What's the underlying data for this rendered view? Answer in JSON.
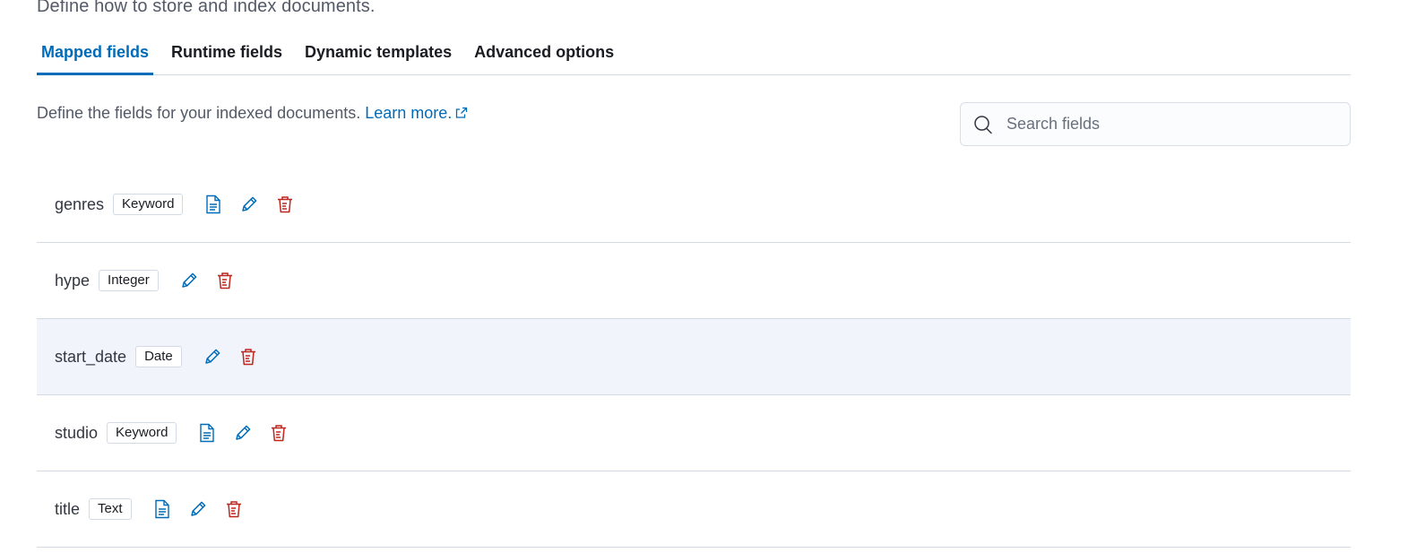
{
  "header": {
    "subtitle": "Define how to store and index documents."
  },
  "tabs": [
    {
      "label": "Mapped fields",
      "active": true
    },
    {
      "label": "Runtime fields",
      "active": false
    },
    {
      "label": "Dynamic templates",
      "active": false
    },
    {
      "label": "Advanced options",
      "active": false
    }
  ],
  "mapped_fields": {
    "description": "Define the fields for your indexed documents.",
    "learn_more_label": "Learn more.",
    "search_placeholder": "Search fields",
    "search_value": "",
    "fields": [
      {
        "name": "genres",
        "type": "Keyword",
        "has_multi_fields": true
      },
      {
        "name": "hype",
        "type": "Integer",
        "has_multi_fields": false
      },
      {
        "name": "start_date",
        "type": "Date",
        "has_multi_fields": false
      },
      {
        "name": "studio",
        "type": "Keyword",
        "has_multi_fields": true
      },
      {
        "name": "title",
        "type": "Text",
        "has_multi_fields": true
      }
    ]
  },
  "icons": {
    "search": "search-icon",
    "external_link": "external-link-icon",
    "multi_fields": "document-icon",
    "edit": "pencil-icon",
    "delete": "trash-icon"
  },
  "colors": {
    "accent": "#006bb8",
    "danger": "#bd271e",
    "border": "#d3dae6",
    "row_hover": "#f1f4fa"
  }
}
